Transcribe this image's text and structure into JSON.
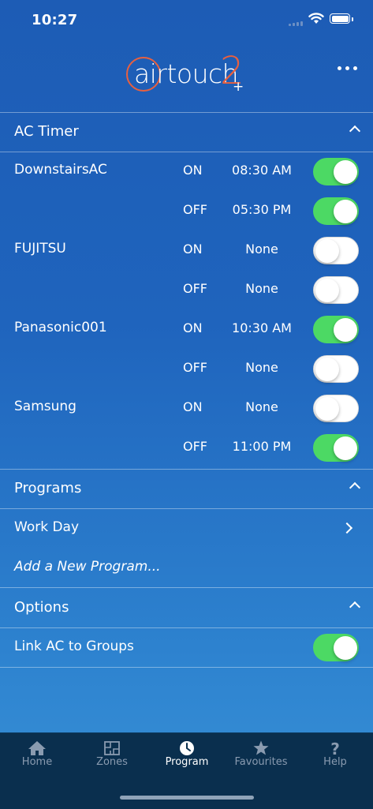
{
  "status_bar": {
    "time": "10:27"
  },
  "header": {
    "logo_text": "airtouch",
    "logo_number": "2",
    "logo_plus": "+"
  },
  "ac_timer": {
    "title": "AC Timer",
    "rows": [
      {
        "device": "DownstairsAC",
        "mode": "ON",
        "time": "08:30 AM",
        "enabled": true
      },
      {
        "device": "",
        "mode": "OFF",
        "time": "05:30 PM",
        "enabled": true
      },
      {
        "device": "FUJITSU",
        "mode": "ON",
        "time": "None",
        "enabled": false
      },
      {
        "device": "",
        "mode": "OFF",
        "time": "None",
        "enabled": false
      },
      {
        "device": "Panasonic001",
        "mode": "ON",
        "time": "10:30 AM",
        "enabled": true
      },
      {
        "device": "",
        "mode": "OFF",
        "time": "None",
        "enabled": false
      },
      {
        "device": "Samsung",
        "mode": "ON",
        "time": "None",
        "enabled": false
      },
      {
        "device": "",
        "mode": "OFF",
        "time": "11:00 PM",
        "enabled": true
      }
    ]
  },
  "programs": {
    "title": "Programs",
    "items": [
      {
        "label": "Work Day"
      }
    ],
    "add_label": "Add a New Program..."
  },
  "options": {
    "title": "Options",
    "items": [
      {
        "label": "Link AC to Groups",
        "enabled": true
      }
    ]
  },
  "tab_bar": {
    "tabs": [
      {
        "label": "Home",
        "icon": "home-icon",
        "active": false
      },
      {
        "label": "Zones",
        "icon": "floorplan-icon",
        "active": false
      },
      {
        "label": "Program",
        "icon": "clock-icon",
        "active": true
      },
      {
        "label": "Favourites",
        "icon": "star-icon",
        "active": false
      },
      {
        "label": "Help",
        "icon": "question-icon",
        "active": false
      }
    ]
  },
  "colors": {
    "accent_orange": "#e8603f",
    "toggle_on": "#4cd964",
    "tab_bar_bg": "#0a2f4e"
  }
}
